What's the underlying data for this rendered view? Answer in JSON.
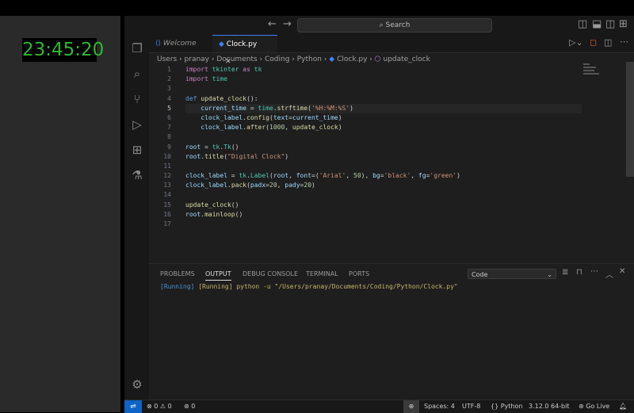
{
  "tk_window": {
    "time": "23:45:20"
  },
  "titlebar": {
    "search_label": "Search"
  },
  "tabs": [
    {
      "label": "Welcome"
    },
    {
      "label": "Clock.py"
    }
  ],
  "breadcrumb": [
    "Users",
    "pranay",
    "Documents",
    "Coding",
    "Python",
    "Clock.py",
    "update_clock"
  ],
  "code_lines": [
    "1",
    "2",
    "3",
    "4",
    "5",
    "6",
    "7",
    "8",
    "9",
    "10",
    "11",
    "12",
    "13",
    "14",
    "15",
    "16",
    "17"
  ],
  "panel": {
    "tabs": [
      "PROBLEMS",
      "OUTPUT",
      "DEBUG CONSOLE",
      "TERMINAL",
      "PORTS"
    ],
    "dropdown_value": "Code",
    "output_text": "[Running] python -u \"/Users/pranay/Documents/Coding/Python/Clock.py\""
  },
  "statusbar": {
    "errors": "0",
    "warnings": "0",
    "ports": "0",
    "spaces": "Spaces: 4",
    "encoding": "UTF-8",
    "language": "Python",
    "interpreter": "3.12.0 64-bit",
    "golive": "Go Live"
  },
  "colors": {
    "accent": "#0e63c6",
    "clock_fg": "#2eb82e",
    "editor_bg": "#1e1e1e"
  }
}
